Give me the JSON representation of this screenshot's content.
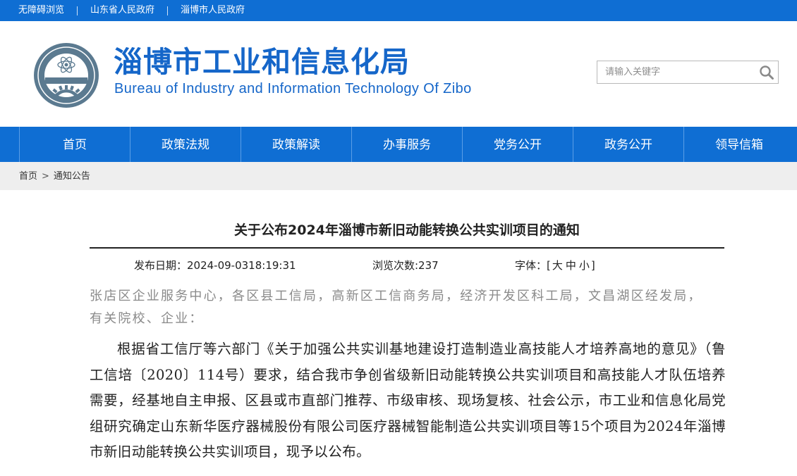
{
  "topbar": {
    "links": [
      "无障碍浏览",
      "山东省人民政府",
      "淄博市人民政府"
    ]
  },
  "header": {
    "title": "淄博市工业和信息化局",
    "subtitle": "Bureau of Industry and Information Technology Of Zibo",
    "search_placeholder": "请输入关键字",
    "logo_icon": "emblem-icon",
    "search_icon": "search-icon"
  },
  "nav": {
    "items": [
      "首页",
      "政策法规",
      "政策解读",
      "办事服务",
      "党务公开",
      "政务公开",
      "领导信箱"
    ]
  },
  "breadcrumb": {
    "home": "首页",
    "separator": ">",
    "current": "通知公告"
  },
  "article": {
    "title": "关于公布2024年淄博市新旧动能转换公共实训项目的通知",
    "publish_date": "发布日期：2024-09-0318:19:31",
    "views": "浏览次数:237",
    "font_label": "字体：[",
    "font_large": "大",
    "font_medium": "中",
    "font_small": "小",
    "font_close": "]",
    "recipients": "张店区企业服务中心，各区县工信局，高新区工信商务局，经济开发区科工局，文昌湖区经发局，有关院校、企业：",
    "paragraph": "根据省工信厅等六部门《关于加强公共实训基地建设打造制造业高技能人才培养高地的意见》（鲁工信培〔2020〕114号）要求，结合我市争创省级新旧动能转换公共实训项目和高技能人才队伍培养需要，经基地自主申报、区县或市直部门推荐、市级审核、现场复核、社会公示，市工业和信息化局党组研究确定山东新华医疗器械股份有限公司医疗器械智能制造公共实训项目等15个项目为2024年淄博市新旧动能转换公共实训项目，现予以公布。"
  },
  "colors": {
    "brand_blue": "#0f6ed3",
    "title_blue": "#1566c9",
    "crumb_bg": "#eeeeee"
  }
}
